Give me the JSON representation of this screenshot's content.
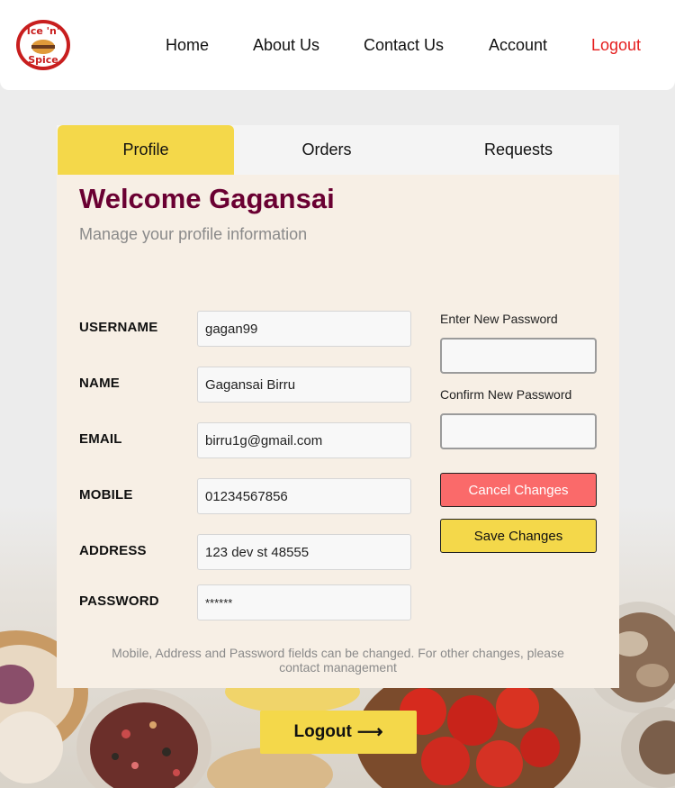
{
  "header": {
    "logo_icon": "ice-n-spice-logo",
    "nav": [
      {
        "label": "Home"
      },
      {
        "label": "About Us"
      },
      {
        "label": "Contact Us"
      },
      {
        "label": "Account"
      },
      {
        "label": "Logout"
      }
    ]
  },
  "tabs": [
    {
      "label": "Profile",
      "active": true
    },
    {
      "label": "Orders",
      "active": false
    },
    {
      "label": "Requests",
      "active": false
    }
  ],
  "profile": {
    "welcome": "Welcome Gagansai",
    "subtitle": "Manage your profile information",
    "fields": [
      {
        "label": "USERNAME",
        "value": "gagan99"
      },
      {
        "label": "NAME",
        "value": "Gagansai Birru"
      },
      {
        "label": "EMAIL",
        "value": "birru1g@gmail.com"
      },
      {
        "label": "MOBILE",
        "value": "01234567856"
      },
      {
        "label": "ADDRESS",
        "value": "123 dev st 48555"
      },
      {
        "label": "PASSWORD",
        "value": "******"
      }
    ],
    "new_password_label": "Enter New Password",
    "new_password_value": "",
    "confirm_password_label": "Confirm New Password",
    "confirm_password_value": "",
    "cancel_label": "Cancel Changes",
    "save_label": "Save Changes",
    "note": "Mobile, Address and Password fields can be changed. For other changes, please contact management"
  },
  "logout_button": {
    "label": "Logout",
    "icon": "arrow-right-icon"
  },
  "colors": {
    "accent_yellow": "#f4d84a",
    "title_maroon": "#6a0032",
    "logout_red": "#e51e1e",
    "cancel_red": "#fa6a6a",
    "card_bg": "#f7efe5"
  }
}
